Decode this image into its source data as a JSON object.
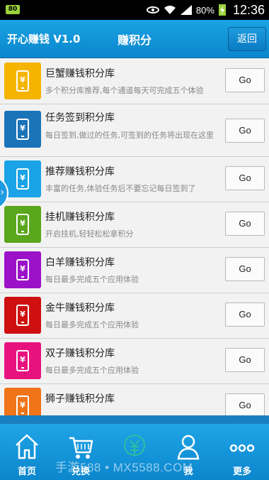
{
  "status_bar": {
    "left_badge": "80",
    "battery_percent": "80%",
    "time": "12:36"
  },
  "header": {
    "app_title": "开心赚钱 V1.0",
    "page_title": "赚积分",
    "back_label": "返回"
  },
  "list": {
    "items": [
      {
        "title": "巨蟹赚钱积分库",
        "desc": "多个积分库推荐,每个通道每天可完成五个体验",
        "button": "Go",
        "color": "#f5b400"
      },
      {
        "title": "任务签到积分库",
        "desc": "每日签到,做过的任务,可签到的任务将出现在这里",
        "button": "Go",
        "color": "#1b73b8"
      },
      {
        "title": "推荐赚钱积分库",
        "desc": "丰富的任务,体验任务后不要忘记每日签到了",
        "button": "Go",
        "color": "#1aa3e6"
      },
      {
        "title": "挂机赚钱积分库",
        "desc": "开启挂机,轻轻松松拿积分",
        "button": "Go",
        "color": "#5aa61c"
      },
      {
        "title": "白羊赚钱积分库",
        "desc": "每日最多完成五个应用体验",
        "button": "Go",
        "color": "#9b12c9"
      },
      {
        "title": "金牛赚钱积分库",
        "desc": "每日最多完成五个应用体验",
        "button": "Go",
        "color": "#cf1010"
      },
      {
        "title": "双子赚钱积分库",
        "desc": "每日最多完成五个应用体验",
        "button": "Go",
        "color": "#e8127e"
      },
      {
        "title": "狮子赚钱积分库",
        "desc": "",
        "button": "Go",
        "color": "#f07418"
      }
    ]
  },
  "side_tab": {
    "glyph": "›"
  },
  "bottom_nav": {
    "items": [
      {
        "label": "首页",
        "icon": "home-icon"
      },
      {
        "label": "兑换",
        "icon": "cart-icon"
      },
      {
        "label": "",
        "icon": "money-icon"
      },
      {
        "label": "我",
        "icon": "user-icon"
      },
      {
        "label": "更多",
        "icon": "more-icon"
      }
    ]
  },
  "watermark": "手游588 • MX5588.COM"
}
